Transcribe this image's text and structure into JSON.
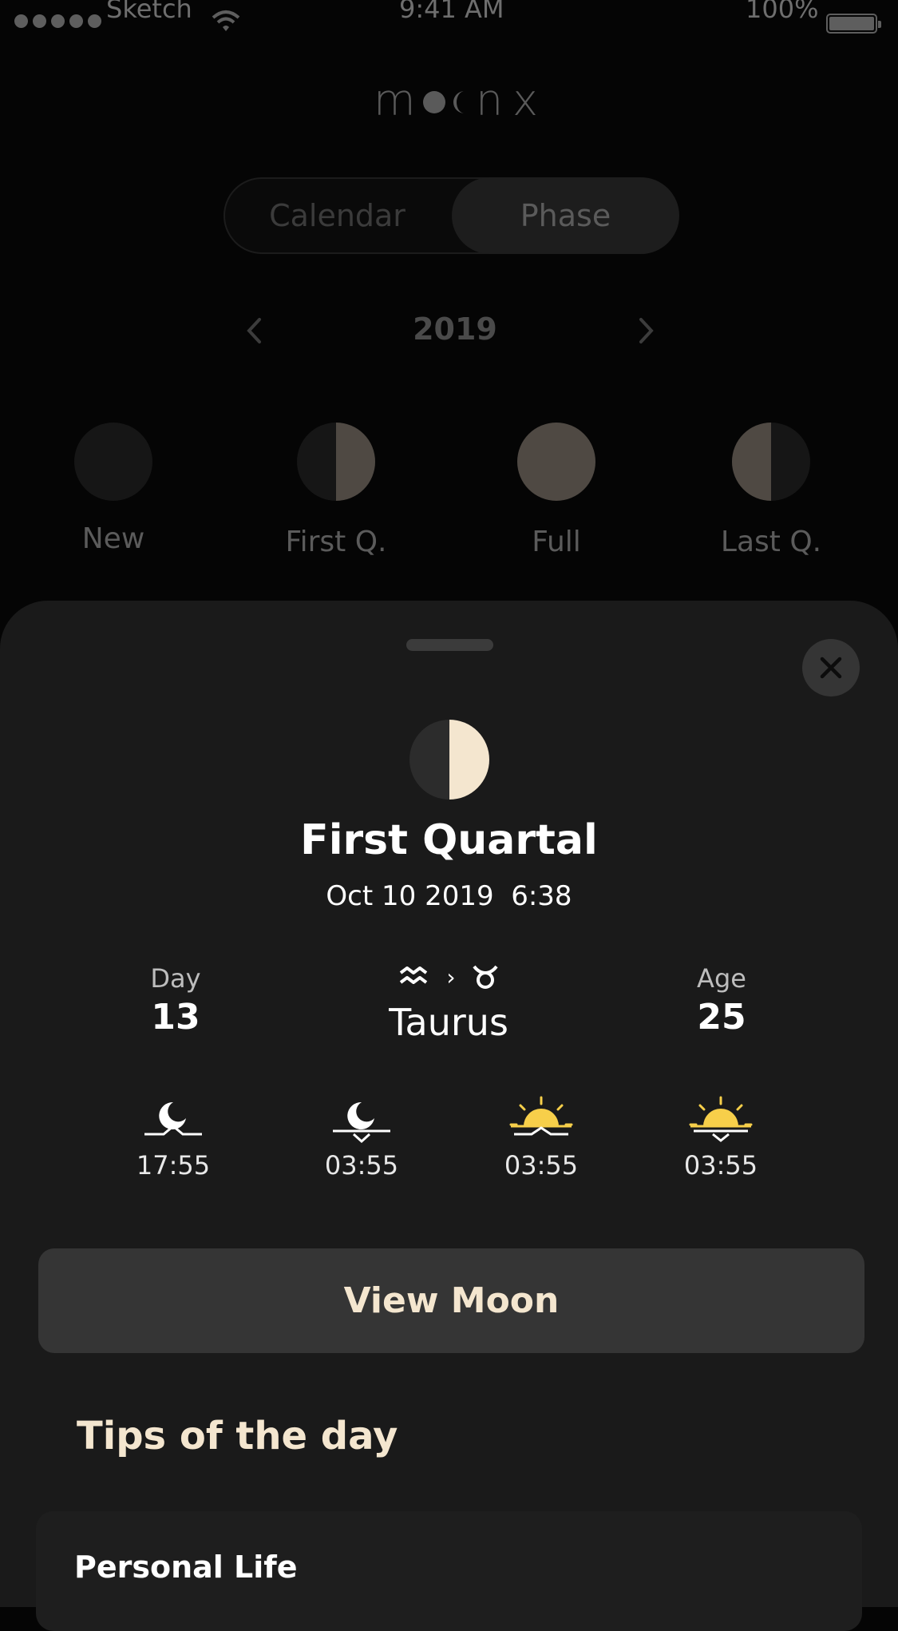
{
  "status_bar": {
    "carrier": "Sketch",
    "time": "9:41 AM",
    "battery": "100%"
  },
  "logo": {
    "text": "moonx"
  },
  "segmented": {
    "calendar": "Calendar",
    "phase": "Phase",
    "selected": "Phase"
  },
  "year_nav": {
    "year": "2019",
    "prev_icon": "chevron-left-icon",
    "next_icon": "chevron-right-icon"
  },
  "phases": [
    {
      "label": "New"
    },
    {
      "label": "First Q."
    },
    {
      "label": "Full"
    },
    {
      "label": "Last Q."
    }
  ],
  "detail": {
    "title": "First Quartal",
    "date": "Oct 10 2019  6:38",
    "day_label": "Day",
    "day_value": "13",
    "sign_from_icon": "aquarius-icon",
    "sign_to_icon": "taurus-icon",
    "sign_arrow": "›",
    "sign_name": "Taurus",
    "age_label": "Age",
    "age_value": "25",
    "times": [
      {
        "icon": "moonrise-icon",
        "time": "17:55"
      },
      {
        "icon": "moonset-icon",
        "time": "03:55"
      },
      {
        "icon": "sunrise-icon",
        "time": "03:55"
      },
      {
        "icon": "sunset-icon",
        "time": "03:55"
      }
    ],
    "view_button": "View Moon"
  },
  "tips": {
    "title": "Tips of the day",
    "card_title": "Personal Life"
  },
  "colors": {
    "accent_cream": "#f4e6cf",
    "sun_yellow": "#f7cf4a",
    "sheet_bg": "#1a1a1a"
  }
}
